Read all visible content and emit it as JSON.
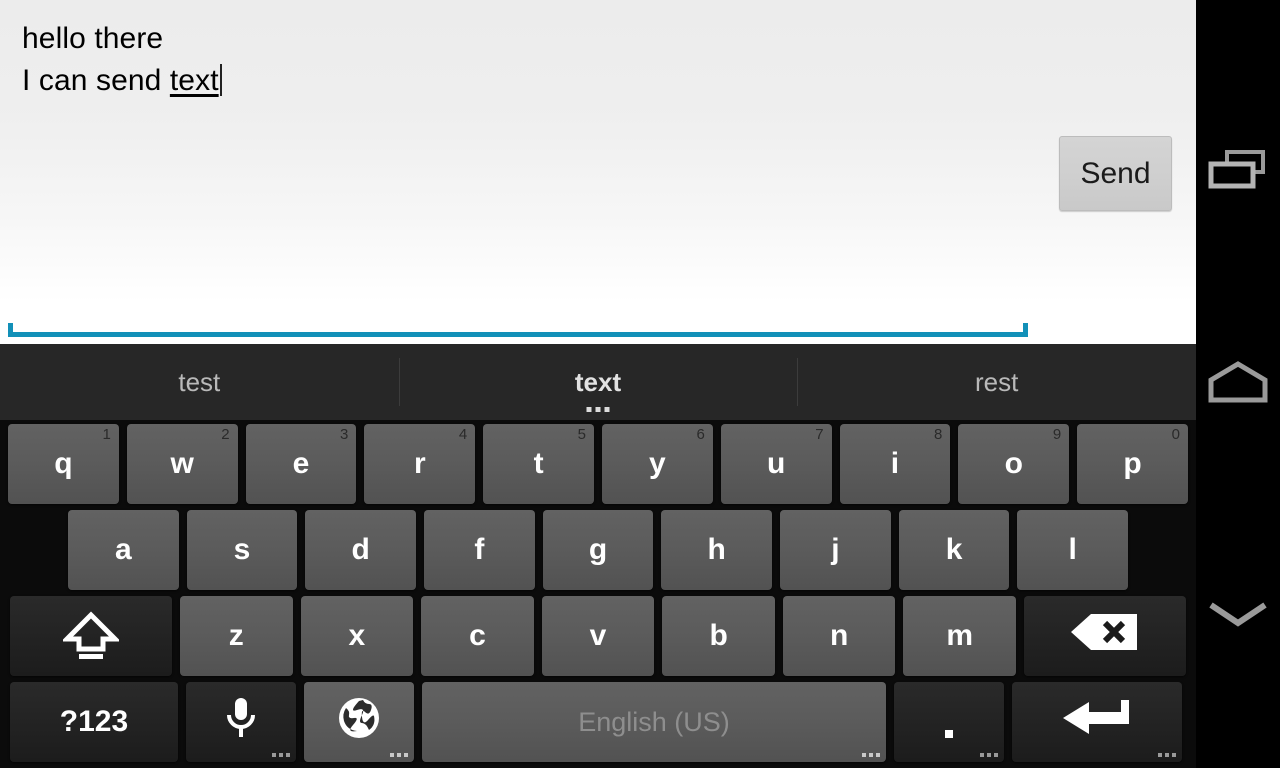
{
  "app": {
    "compose": {
      "line1": "hello there",
      "line2_prefix": "I can send ",
      "line2_composing": "text"
    },
    "send_button_label": "Send"
  },
  "keyboard": {
    "suggestions": [
      {
        "label": "test",
        "selected": false,
        "has_more": false
      },
      {
        "label": "text",
        "selected": true,
        "has_more": true
      },
      {
        "label": "rest",
        "selected": false,
        "has_more": false
      }
    ],
    "row1": [
      {
        "label": "q",
        "hint": "1"
      },
      {
        "label": "w",
        "hint": "2"
      },
      {
        "label": "e",
        "hint": "3"
      },
      {
        "label": "r",
        "hint": "4"
      },
      {
        "label": "t",
        "hint": "5"
      },
      {
        "label": "y",
        "hint": "6"
      },
      {
        "label": "u",
        "hint": "7"
      },
      {
        "label": "i",
        "hint": "8"
      },
      {
        "label": "o",
        "hint": "9"
      },
      {
        "label": "p",
        "hint": "0"
      }
    ],
    "row2": [
      {
        "label": "a"
      },
      {
        "label": "s"
      },
      {
        "label": "d"
      },
      {
        "label": "f"
      },
      {
        "label": "g"
      },
      {
        "label": "h"
      },
      {
        "label": "j"
      },
      {
        "label": "k"
      },
      {
        "label": "l"
      }
    ],
    "row3": [
      {
        "label": "z"
      },
      {
        "label": "x"
      },
      {
        "label": "c"
      },
      {
        "label": "v"
      },
      {
        "label": "b"
      },
      {
        "label": "n"
      },
      {
        "label": "m"
      }
    ],
    "shift_key": {
      "icon": "shift-icon"
    },
    "backspace_key": {
      "icon": "backspace-icon"
    },
    "row4": {
      "symbols_label": "?123",
      "mic_icon": "microphone-icon",
      "globe_icon": "globe-icon",
      "space_label": "English (US)",
      "period_label": ".",
      "enter_icon": "enter-icon"
    }
  },
  "navbar": {
    "recents_icon": "recents-icon",
    "home_icon": "home-icon",
    "back_icon": "back-icon"
  },
  "colors": {
    "focus_underline": "#1290b8",
    "keyboard_bg": "#0b0b0b",
    "suggestion_bar_bg": "#272727",
    "key_bg": "#5b5b5b",
    "key_dark_bg": "#232323"
  }
}
